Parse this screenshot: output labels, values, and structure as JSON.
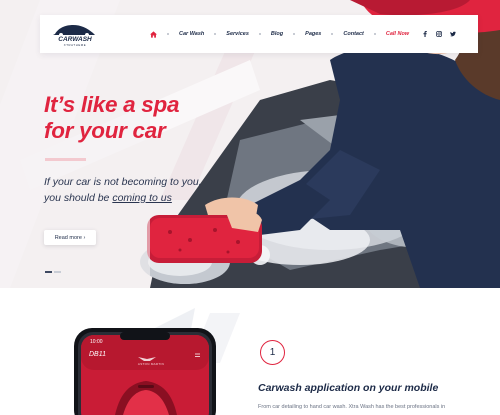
{
  "brand": {
    "logo_main": "CARWASH",
    "logo_sub": "XTRATHEME"
  },
  "nav": {
    "items": [
      {
        "label": "Car Wash"
      },
      {
        "label": "Services"
      },
      {
        "label": "Blog"
      },
      {
        "label": "Pages"
      },
      {
        "label": "Contact"
      }
    ],
    "call_label": "Call Now",
    "home_icon": "home-icon",
    "social_icons": [
      "facebook-icon",
      "instagram-icon",
      "twitter-icon"
    ]
  },
  "hero": {
    "title_line1": "It’s like a spa",
    "title_line2": "for your car",
    "sub_line1": "If your car is not becoming to you,",
    "sub_line2_prefix": "you should be ",
    "sub_link": "coming to us",
    "readmore_label": "Read more ›",
    "slider_count": 2
  },
  "phone": {
    "time": "10:00",
    "model": "DB11",
    "brand_text": "ASTON MARTIN"
  },
  "feature": {
    "step_number": "1",
    "title": "Carwash application on your mobile",
    "text": "From car detailing to hand car wash. Xtra Wash has the best professionals in"
  },
  "colors": {
    "accent_red": "#e0243f",
    "navy": "#1c2a47",
    "jacket_navy": "#23314f",
    "hero_bg": "#f4f0f1"
  }
}
